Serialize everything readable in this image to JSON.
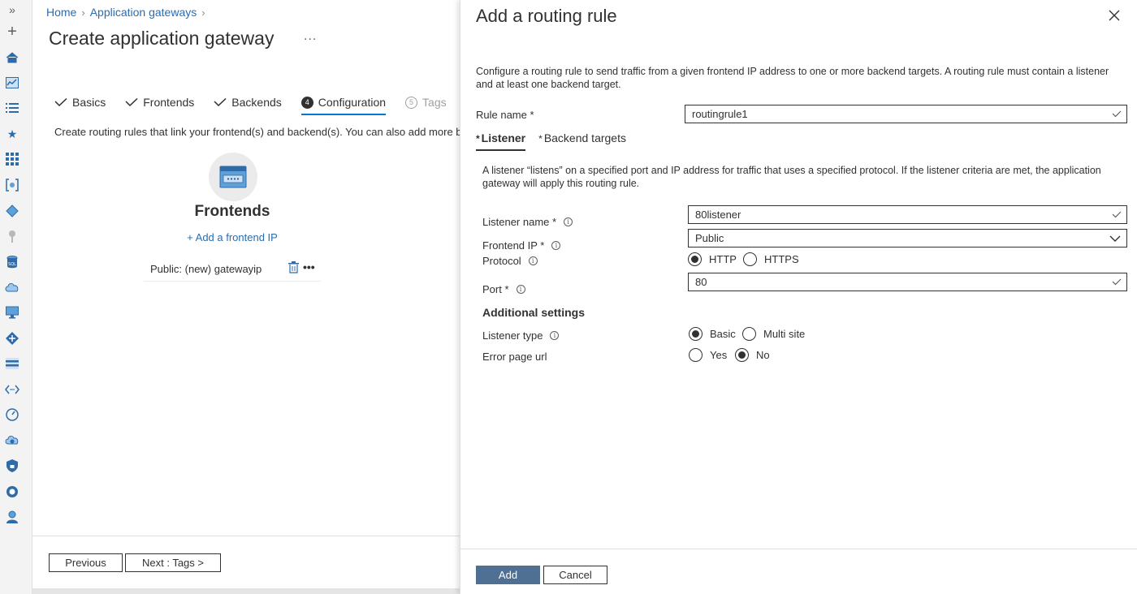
{
  "rail": {
    "items": [
      "expand-icon",
      "create-resource-icon",
      "home-icon",
      "dashboard-icon",
      "all-services-icon",
      "favorites-star-icon",
      "all-resources-grid-icon",
      "resource-groups-icon",
      "app-services-icon",
      "key-vault-icon",
      "sql-icon",
      "cloud-icon",
      "monitor-icon",
      "network-icon",
      "storage-icon",
      "code-icon",
      "speed-icon",
      "cloud-shield-icon",
      "security-icon",
      "cost-icon",
      "user-icon"
    ]
  },
  "breadcrumb": {
    "home": "Home",
    "app_gateways": "Application gateways"
  },
  "page": {
    "title": "Create application gateway",
    "more": "..."
  },
  "wizard": {
    "steps": [
      {
        "label": "Basics",
        "state": "done"
      },
      {
        "label": "Frontends",
        "state": "done"
      },
      {
        "label": "Backends",
        "state": "done"
      },
      {
        "label": "Configuration",
        "number": "4",
        "state": "active"
      },
      {
        "label": "Tags",
        "number": "5",
        "state": "disabled"
      }
    ]
  },
  "config": {
    "description": "Create routing rules that link your frontend(s) and backend(s). You can also add more ba",
    "frontends_title": "Frontends",
    "add_frontend": "+ Add a frontend IP",
    "frontend_item": "Public: (new) gatewayip",
    "item_more": "•••"
  },
  "footer": {
    "previous": "Previous",
    "next": "Next : Tags >"
  },
  "pane": {
    "title": "Add a routing rule",
    "description": "Configure a routing rule to send traffic from a given frontend IP address to one or more backend targets. A routing rule must contain a listener and at least one backend target.",
    "rule_name_label": "Rule name *",
    "rule_name_value": "routingrule1",
    "tabs": [
      {
        "req": "*",
        "label": "Listener",
        "active": true
      },
      {
        "req": "*",
        "label": "Backend targets",
        "active": false
      }
    ],
    "listener_desc": "A listener “listens” on a specified port and IP address for traffic that uses a specified protocol. If the listener criteria are met, the application gateway will apply this routing rule.",
    "listener_name_label": "Listener name *",
    "listener_name_value": "80listener",
    "frontend_ip_label": "Frontend IP *",
    "frontend_ip_value": "Public",
    "protocol_label": "Protocol",
    "protocol_options": [
      "HTTP",
      "HTTPS"
    ],
    "protocol_selected": "HTTP",
    "port_label": "Port *",
    "port_value": "80",
    "additional_settings": "Additional settings",
    "listener_type_label": "Listener type",
    "listener_type_options": [
      "Basic",
      "Multi site"
    ],
    "listener_type_selected": "Basic",
    "error_page_label": "Error page url",
    "error_page_options": [
      "Yes",
      "No"
    ],
    "error_page_selected": "No",
    "info_glyph": "i",
    "add_button": "Add",
    "cancel_button": "Cancel"
  },
  "colors": {
    "link": "#2b6cb0",
    "accent_tab": "#0078d4",
    "primary_button": "#4f6f93",
    "rail_icon": "#2f6ba8"
  }
}
